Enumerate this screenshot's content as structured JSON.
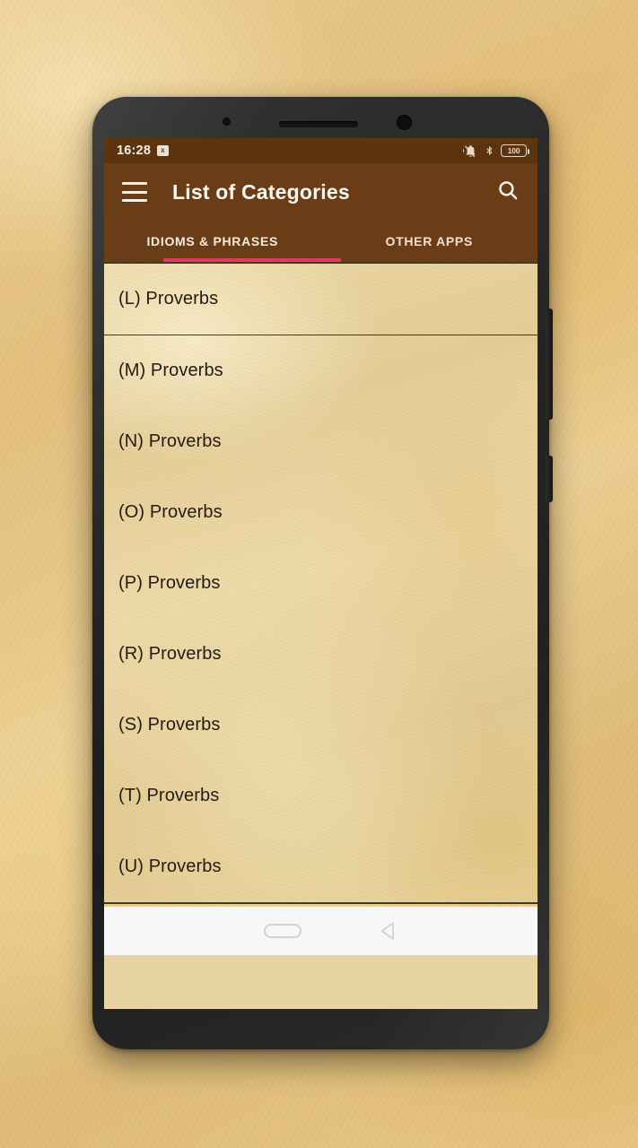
{
  "statusbar": {
    "time": "16:28",
    "badge_label": "x",
    "icons": [
      "vibrate-off-icon",
      "bluetooth-icon",
      "battery-icon"
    ],
    "battery_level": "100"
  },
  "appbar": {
    "menu_icon": "hamburger-menu-icon",
    "title": "List of Categories",
    "search_icon": "search-icon",
    "background_color": "#6b3d17"
  },
  "tabs": {
    "items": [
      {
        "label": "IDIOMS & PHRASES",
        "active": true
      },
      {
        "label": "OTHER APPS",
        "active": false
      }
    ],
    "indicator_color": "#e13a5e"
  },
  "list": {
    "items": [
      {
        "label": "(L) Proverbs"
      },
      {
        "label": "(M) Proverbs"
      },
      {
        "label": "(N) Proverbs"
      },
      {
        "label": "(O) Proverbs"
      },
      {
        "label": "(P) Proverbs"
      },
      {
        "label": "(R) Proverbs"
      },
      {
        "label": "(S) Proverbs"
      },
      {
        "label": "(T) Proverbs"
      },
      {
        "label": "(U) Proverbs"
      }
    ]
  },
  "navbar": {
    "home_icon": "home-pill-icon",
    "back_icon": "back-triangle-icon"
  }
}
